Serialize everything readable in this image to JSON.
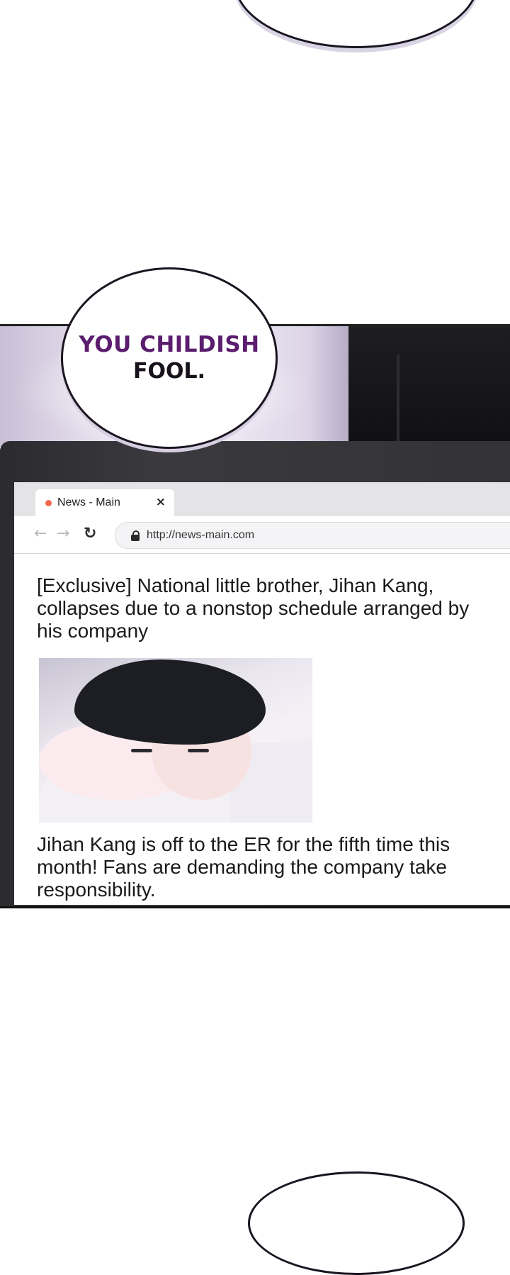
{
  "speech_bubble": {
    "line1": "YOU CHILDISH",
    "line2": "FOOL."
  },
  "browser": {
    "tab_title": "News - Main",
    "tab_close": "×",
    "nav_back": "←",
    "nav_forward": "→",
    "nav_reload": "↻",
    "url": "http://news-main.com"
  },
  "article": {
    "headline": "[Exclusive] National little brother, Jihan Kang, collapses due to a nonstop schedule arranged by his company",
    "body": "Jihan Kang is off to the ER for the fifth time this month! Fans are demanding the company take responsibility."
  },
  "colors": {
    "bubble_text_accent": "#5b1d6e",
    "tab_dot": "#ef6a4d"
  }
}
